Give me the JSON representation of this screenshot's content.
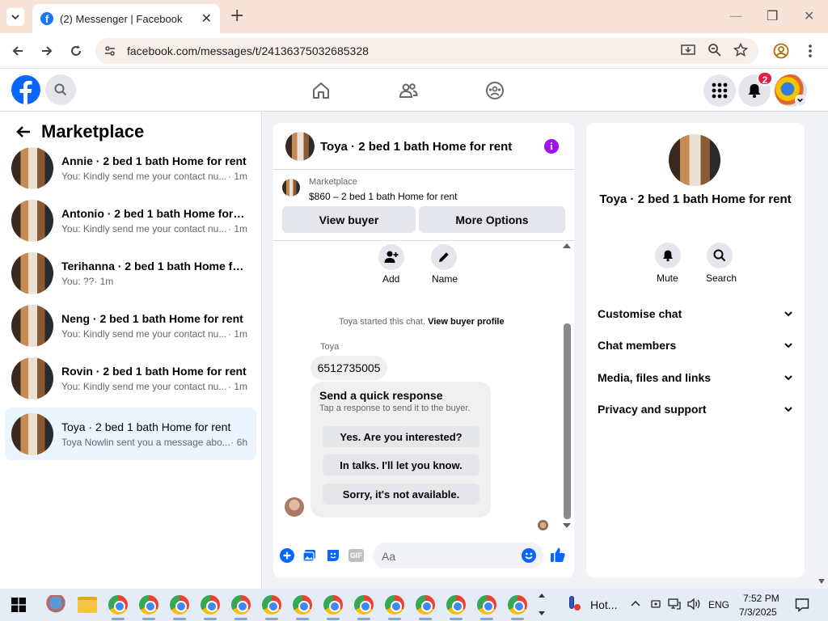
{
  "browser": {
    "tab_title": "(2) Messenger | Facebook",
    "tab_favicon": "f",
    "url": "facebook.com/messages/t/24136375032685328",
    "new_tab": "+",
    "tab_close": "✕",
    "minimize": "—",
    "restore": "❐",
    "close": "✕"
  },
  "fb": {
    "notification_count": "2",
    "accent": "#1877f2"
  },
  "left": {
    "title": "Marketplace",
    "conversations": [
      {
        "name": "Annie · 2 bed 1 bath Home for rent",
        "preview": "You: Kindly send me your contact nu...",
        "time": "· 1m"
      },
      {
        "name": "Antonio · 2 bed 1 bath Home for r...",
        "preview": "You: Kindly send me your contact nu...",
        "time": "· 1m"
      },
      {
        "name": "Terihanna · 2 bed 1 bath Home for ...",
        "preview": "You: ??",
        "time": "· 1m"
      },
      {
        "name": "Neng · 2 bed 1 bath Home for rent",
        "preview": "You: Kindly send me your contact nu...",
        "time": "· 1m"
      },
      {
        "name": "Rovin · 2 bed 1 bath Home for rent",
        "preview": "You: Kindly send me your contact nu...",
        "time": "· 1m"
      },
      {
        "name": "Toya · 2 bed 1 bath Home for rent",
        "preview": "Toya Nowlin sent you a message abo...",
        "time": "· 6h"
      }
    ]
  },
  "chat": {
    "title": "Toya · 2 bed 1 bath Home for rent",
    "listing_source": "Marketplace",
    "listing": "$860 – 2 bed 1 bath Home for rent",
    "view_buyer": "View buyer",
    "more_options": "More Options",
    "add_label": "Add",
    "name_label": "Name",
    "started_text": "Toya started this chat.",
    "view_buyer_profile": "View buyer profile",
    "sender": "Toya",
    "message": "6512735005",
    "quick_title": "Send a quick response",
    "quick_sub": "Tap a response to send it to the buyer.",
    "quick_responses": [
      "Yes. Are you interested?",
      "In talks. I'll let you know.",
      "Sorry, it's not available."
    ],
    "input_placeholder": "Aa"
  },
  "info": {
    "title": "Toya · 2 bed 1 bath Home for rent",
    "mute": "Mute",
    "search": "Search",
    "sections": [
      "Customise chat",
      "Chat members",
      "Media, files and links",
      "Privacy and support"
    ]
  },
  "taskbar": {
    "weather": "Hot...",
    "lang": "ENG",
    "time": "7:52 PM",
    "date": "7/3/2025"
  }
}
